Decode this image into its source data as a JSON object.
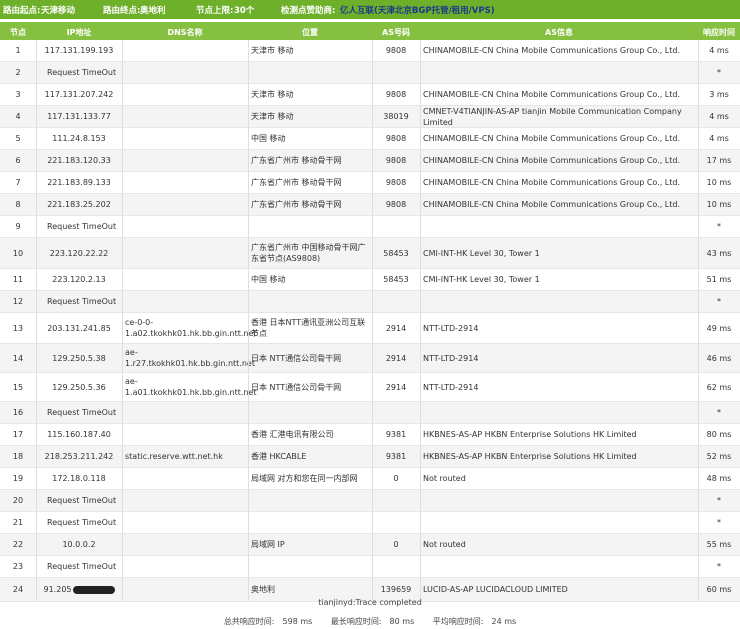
{
  "header": {
    "origin_label": "路由起点:",
    "origin_value": "天津移动",
    "dest_label": "路由终点:",
    "dest_value": "奥地利",
    "hops_label": "节点上限:",
    "hops_value": "30个",
    "sponsor_label": "检测点赞助商:",
    "sponsor_name": "亿人互联",
    "sponsor_desc": "(天津北京BGP托管/租用/VPS)"
  },
  "columns": [
    "节点",
    "IP地址",
    "DNS名称",
    "位置",
    "AS号码",
    "AS信息",
    "响应时间"
  ],
  "rows": [
    {
      "hop": "1",
      "ip": "117.131.199.193",
      "dns": "",
      "loc": "天津市 移动",
      "asn": "9808",
      "asinfo": "CHINAMOBILE-CN China Mobile Communications Group Co., Ltd.",
      "time": "4 ms"
    },
    {
      "hop": "2",
      "ip": "Request TimeOut",
      "dns": "",
      "loc": "",
      "asn": "",
      "asinfo": "",
      "time": "*"
    },
    {
      "hop": "3",
      "ip": "117.131.207.242",
      "dns": "",
      "loc": "天津市 移动",
      "asn": "9808",
      "asinfo": "CHINAMOBILE-CN China Mobile Communications Group Co., Ltd.",
      "time": "3 ms"
    },
    {
      "hop": "4",
      "ip": "117.131.133.77",
      "dns": "",
      "loc": "天津市 移动",
      "asn": "38019",
      "asinfo": "CMNET-V4TIANJIN-AS-AP tianjin Mobile Communication Company Limited",
      "time": "4 ms"
    },
    {
      "hop": "5",
      "ip": "111.24.8.153",
      "dns": "",
      "loc": "中国 移动",
      "asn": "9808",
      "asinfo": "CHINAMOBILE-CN China Mobile Communications Group Co., Ltd.",
      "time": "4 ms"
    },
    {
      "hop": "6",
      "ip": "221.183.120.33",
      "dns": "",
      "loc": "广东省广州市 移动骨干网",
      "asn": "9808",
      "asinfo": "CHINAMOBILE-CN China Mobile Communications Group Co., Ltd.",
      "time": "17 ms"
    },
    {
      "hop": "7",
      "ip": "221.183.89.133",
      "dns": "",
      "loc": "广东省广州市 移动骨干网",
      "asn": "9808",
      "asinfo": "CHINAMOBILE-CN China Mobile Communications Group Co., Ltd.",
      "time": "10 ms"
    },
    {
      "hop": "8",
      "ip": "221.183.25.202",
      "dns": "",
      "loc": "广东省广州市 移动骨干网",
      "asn": "9808",
      "asinfo": "CHINAMOBILE-CN China Mobile Communications Group Co., Ltd.",
      "time": "10 ms"
    },
    {
      "hop": "9",
      "ip": "Request TimeOut",
      "dns": "",
      "loc": "",
      "asn": "",
      "asinfo": "",
      "time": "*"
    },
    {
      "hop": "10",
      "ip": "223.120.22.22",
      "dns": "",
      "loc": "广东省广州市 中国移动骨干网广东省节点(AS9808)",
      "asn": "58453",
      "asinfo": "CMI-INT-HK Level 30, Tower 1",
      "time": "43 ms"
    },
    {
      "hop": "11",
      "ip": "223.120.2.13",
      "dns": "",
      "loc": "中国 移动",
      "asn": "58453",
      "asinfo": "CMI-INT-HK Level 30, Tower 1",
      "time": "51 ms"
    },
    {
      "hop": "12",
      "ip": "Request TimeOut",
      "dns": "",
      "loc": "",
      "asn": "",
      "asinfo": "",
      "time": "*"
    },
    {
      "hop": "13",
      "ip": "203.131.241.85",
      "dns": "ce-0-0-1.a02.tkokhk01.hk.bb.gin.ntt.net",
      "loc": "香港 日本NTT通讯亚洲公司互联节点",
      "asn": "2914",
      "asinfo": "NTT-LTD-2914",
      "time": "49 ms"
    },
    {
      "hop": "14",
      "ip": "129.250.5.38",
      "dns": "ae-1.r27.tkokhk01.hk.bb.gin.ntt.net",
      "loc": "日本 NTT通信公司骨干网",
      "asn": "2914",
      "asinfo": "NTT-LTD-2914",
      "time": "46 ms"
    },
    {
      "hop": "15",
      "ip": "129.250.5.36",
      "dns": "ae-1.a01.tkokhk01.hk.bb.gin.ntt.net",
      "loc": "日本 NTT通信公司骨干网",
      "asn": "2914",
      "asinfo": "NTT-LTD-2914",
      "time": "62 ms"
    },
    {
      "hop": "16",
      "ip": "Request TimeOut",
      "dns": "",
      "loc": "",
      "asn": "",
      "asinfo": "",
      "time": "*"
    },
    {
      "hop": "17",
      "ip": "115.160.187.40",
      "dns": "",
      "loc": "香港 汇港电讯有限公司",
      "asn": "9381",
      "asinfo": "HKBNES-AS-AP HKBN Enterprise Solutions HK Limited",
      "time": "80 ms"
    },
    {
      "hop": "18",
      "ip": "218.253.211.242",
      "dns": "static.reserve.wtt.net.hk",
      "loc": "香港 HKCABLE",
      "asn": "9381",
      "asinfo": "HKBNES-AS-AP HKBN Enterprise Solutions HK Limited",
      "time": "52 ms"
    },
    {
      "hop": "19",
      "ip": "172.18.0.118",
      "dns": "",
      "loc": "局域网 对方和您在同一内部网",
      "asn": "0",
      "asinfo": "Not routed",
      "time": "48 ms"
    },
    {
      "hop": "20",
      "ip": "Request TimeOut",
      "dns": "",
      "loc": "",
      "asn": "",
      "asinfo": "",
      "time": "*"
    },
    {
      "hop": "21",
      "ip": "Request TimeOut",
      "dns": "",
      "loc": "",
      "asn": "",
      "asinfo": "",
      "time": "*"
    },
    {
      "hop": "22",
      "ip": "10.0.0.2",
      "dns": "",
      "loc": "局域网 IP",
      "asn": "0",
      "asinfo": "Not routed",
      "time": "55 ms"
    },
    {
      "hop": "23",
      "ip": "Request TimeOut",
      "dns": "",
      "loc": "",
      "asn": "",
      "asinfo": "",
      "time": "*"
    },
    {
      "hop": "24",
      "ip": "91.205",
      "dns": "",
      "loc": "奥地利",
      "asn": "139659",
      "asinfo": "LUCID-AS-AP LUCIDACLOUD LIMITED",
      "time": "60 ms",
      "redacted": true
    }
  ],
  "footer": {
    "message": "tianjinyd:Trace completed",
    "total_label": "总共响应时间:",
    "total_value": "598 ms",
    "max_label": "最长响应时间:",
    "max_value": "80 ms",
    "avg_label": "平均响应时间:",
    "avg_value": "24 ms"
  }
}
